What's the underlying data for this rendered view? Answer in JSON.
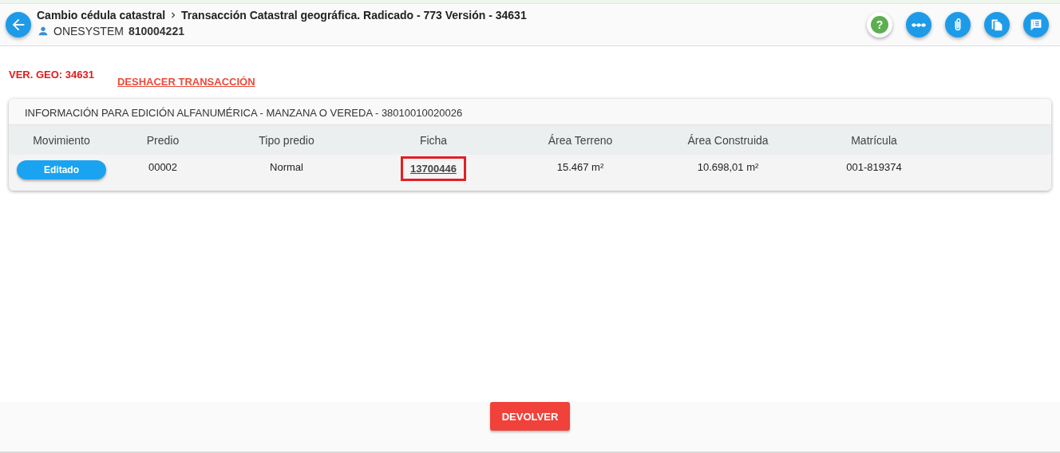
{
  "header": {
    "breadcrumb": [
      "Cambio cédula catastral",
      "Transacción Catastral geográfica. Radicado - 773 Versión - 34631"
    ],
    "user": {
      "name": "ONESYSTEM",
      "id": "810004221"
    },
    "actions": [
      {
        "kind": "help",
        "label": "?"
      },
      {
        "kind": "flow"
      },
      {
        "kind": "attach"
      },
      {
        "kind": "copy"
      },
      {
        "kind": "notes"
      }
    ]
  },
  "version_label": "VER. GEO: 34631",
  "undo_link": "DESHACER TRANSACCIÓN",
  "panel": {
    "title": "INFORMACIÓN PARA EDICIÓN ALFANUMÉRICA - MANZANA O VEREDA - 38010010020026",
    "columns": [
      "Movimiento",
      "Predio",
      "Tipo predio",
      "Ficha",
      "Área Terreno",
      "Área Construida",
      "Matrícula"
    ],
    "rows": [
      {
        "movimiento": "Editado",
        "predio": "00002",
        "tipo_predio": "Normal",
        "ficha": "13700446",
        "ficha_highlighted": true,
        "area_terreno": "15.467 m²",
        "area_construida": "10.698,01 m²",
        "matricula": "001-819374"
      }
    ]
  },
  "footer_button": "DEVOLVER"
}
